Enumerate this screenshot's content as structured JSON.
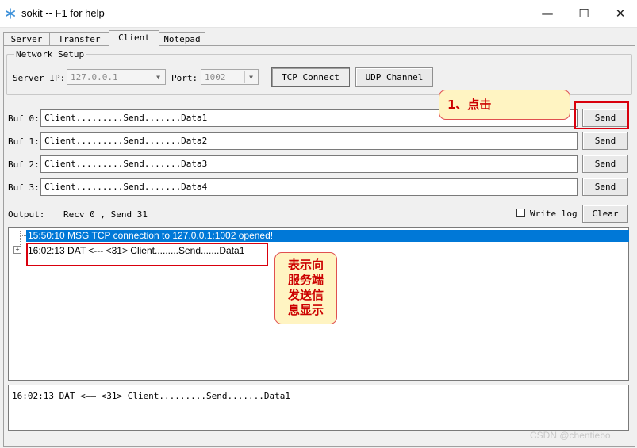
{
  "window": {
    "title": "sokit -- F1 for help",
    "icon": "snowflake-icon",
    "controls": {
      "minimize": "—",
      "maximize": "☐",
      "close": "✕"
    }
  },
  "tabs": [
    {
      "label": "Server",
      "active": false
    },
    {
      "label": "Transfer",
      "active": false
    },
    {
      "label": "Client",
      "active": true
    },
    {
      "label": "Notepad",
      "active": false
    }
  ],
  "network_setup": {
    "label": "Network Setup",
    "server_ip_label": "Server IP:",
    "server_ip_value": "127.0.0.1",
    "port_label": "Port:",
    "port_value": "1002",
    "tcp_connect_label": "TCP Connect",
    "udp_channel_label": "UDP Channel"
  },
  "buffers": [
    {
      "label": "Buf 0:",
      "value": "Client.........Send.......Data1",
      "send_label": "Send"
    },
    {
      "label": "Buf 1:",
      "value": "Client.........Send.......Data2",
      "send_label": "Send"
    },
    {
      "label": "Buf 2:",
      "value": "Client.........Send.......Data3",
      "send_label": "Send"
    },
    {
      "label": "Buf 3:",
      "value": "Client.........Send.......Data4",
      "send_label": "Send"
    }
  ],
  "output": {
    "label": "Output:",
    "stats": "Recv 0 , Send 31",
    "write_log_label": "Write log",
    "write_log_checked": false,
    "clear_label": "Clear"
  },
  "tree": [
    {
      "text": "15:50:10 MSG TCP connection to 127.0.0.1:1002 opened!",
      "selected": true
    },
    {
      "text": "16:02:13 DAT <--- <31> Client.........Send.......Data1",
      "selected": false,
      "expandable": true
    }
  ],
  "log": {
    "text": "16:02:13 DAT <—— <31> Client.........Send.......Data1"
  },
  "annotations": {
    "click_callout": "1、点击",
    "send_info_callout": [
      "表示向",
      "服务端",
      "发送信",
      "息显示"
    ],
    "accent_color": "#d9000d",
    "callout_bg": "#fff4c2"
  },
  "watermark": "CSDN @chentiebo"
}
